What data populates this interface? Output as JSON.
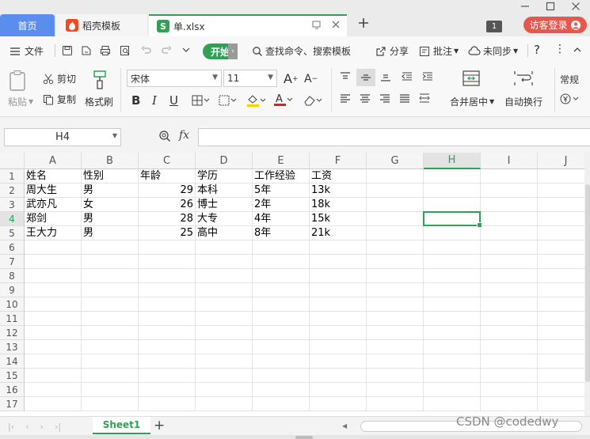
{
  "tabs": {
    "home": "首页",
    "template": "稻壳模板",
    "file": "单.xlsx",
    "file_icon": "S"
  },
  "titlebar": {
    "count_badge": "1",
    "guest_login": "访客登录"
  },
  "menu": {
    "file": "文件",
    "start": "开始",
    "search": "查找命令、搜索模板",
    "share": "分享",
    "comment": "批注",
    "sync": "未同步",
    "help": "?"
  },
  "ribbon": {
    "paste": "粘贴",
    "cut": "剪切",
    "copy": "复制",
    "format_painter": "格式刷",
    "font_name": "宋体",
    "font_size": "11",
    "merge_center": "合并居中",
    "wrap_text": "自动换行",
    "number_format": "常规",
    "font_color": "#e02020",
    "fill_color": "#f7d400"
  },
  "formula_bar": {
    "name_box": "H4",
    "fx": "fx",
    "value": ""
  },
  "sheet": {
    "columns": [
      "A",
      "B",
      "C",
      "D",
      "E",
      "F",
      "G",
      "H",
      "I",
      "J"
    ],
    "selected_column": "H",
    "rows": [
      "1",
      "2",
      "3",
      "4",
      "5",
      "6",
      "7",
      "8",
      "9",
      "10",
      "11",
      "12",
      "13",
      "14",
      "15",
      "16",
      "17"
    ],
    "selected_row": "4",
    "data": [
      [
        "姓名",
        "性别",
        "年龄",
        "学历",
        "工作经验",
        "工资"
      ],
      [
        "周大生",
        "男",
        "29",
        "本科",
        "5年",
        "13k"
      ],
      [
        "武亦凡",
        "女",
        "26",
        "博士",
        "2年",
        "18k"
      ],
      [
        "郑剑",
        "男",
        "28",
        "大专",
        "4年",
        "15k"
      ],
      [
        "王大力",
        "男",
        "25",
        "高中",
        "8年",
        "21k"
      ]
    ],
    "active_tab": "Sheet1",
    "add_sheet": "+"
  },
  "watermark": "CSDN @codedwy",
  "colors": {
    "accent": "#2ea154",
    "home_tab": "#5a8dee",
    "guest_btn": "#e8574e"
  }
}
